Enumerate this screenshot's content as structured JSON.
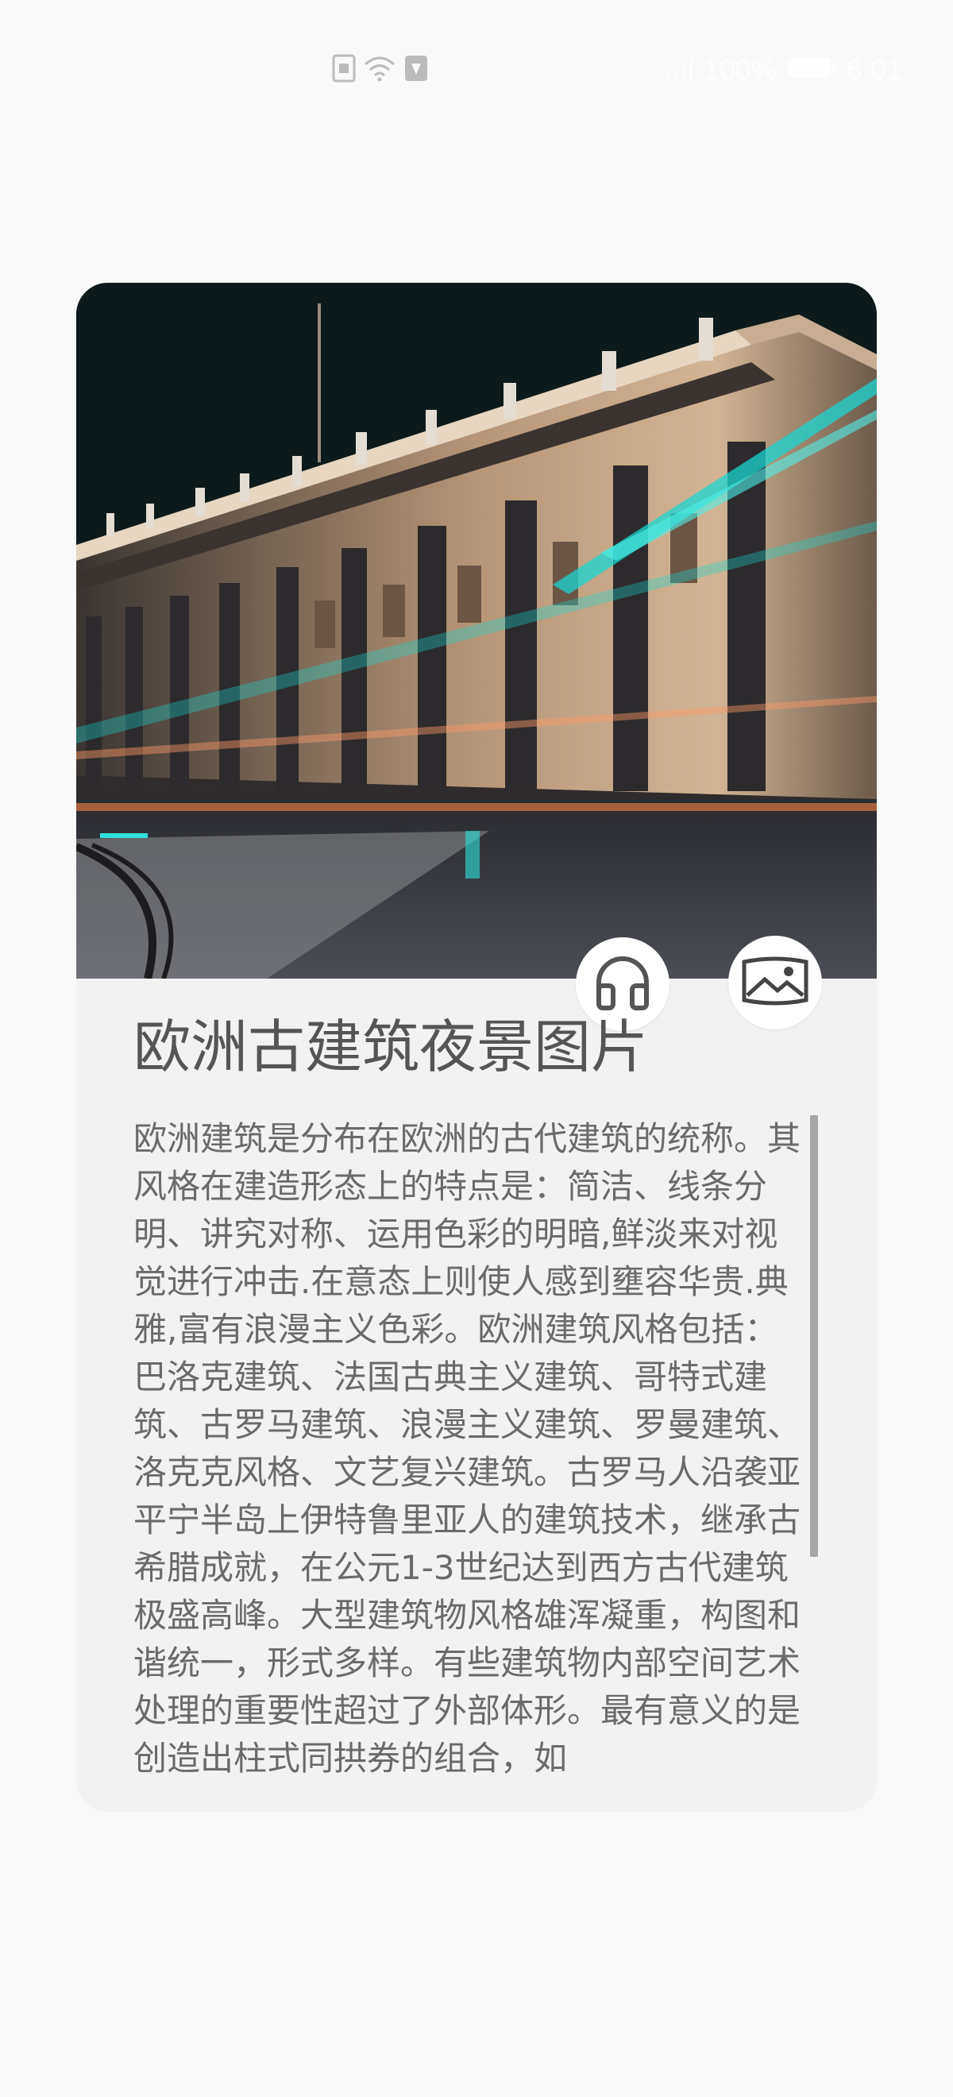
{
  "status_bar": {
    "signal": "..ıl",
    "battery_percent": "100%",
    "time": "6:01",
    "left_icons": [
      "sim-icon",
      "wifi-icon",
      "vpn-icon"
    ]
  },
  "card": {
    "hero_image_alt": "",
    "title": "欧洲古建筑夜景图片",
    "body": "欧洲建筑是分布在欧洲的古代建筑的统称。其风格在建造形态上的特点是：简洁、线条分明、讲究对称、运用色彩的明暗,鲜淡来对视觉进行冲击.在意态上则使人感到壅容华贵.典雅,富有浪漫主义色彩。欧洲建筑风格包括：巴洛克建筑、法国古典主义建筑、哥特式建筑、古罗马建筑、浪漫主义建筑、罗曼建筑、洛克克风格、文艺复兴建筑。古罗马人沿袭亚平宁半岛上伊特鲁里亚人的建筑技术，继承古希腊成就，在公元1-3世纪达到西方古代建筑极盛高峰。大型建筑物风格雄浑凝重，构图和谐统一，形式多样。有些建筑物内部空间艺术处理的重要性超过了外部体形。最有意义的是创造出柱式同拱券的组合，如",
    "buttons": {
      "audio_icon": "headphones-icon",
      "image_icon": "landscape-image-icon"
    }
  },
  "colors": {
    "background": "#f9f9f9",
    "card": "#f2f2f2",
    "title": "#555555",
    "body": "#6a6a6a",
    "accent_teal": "#19d6d2"
  }
}
